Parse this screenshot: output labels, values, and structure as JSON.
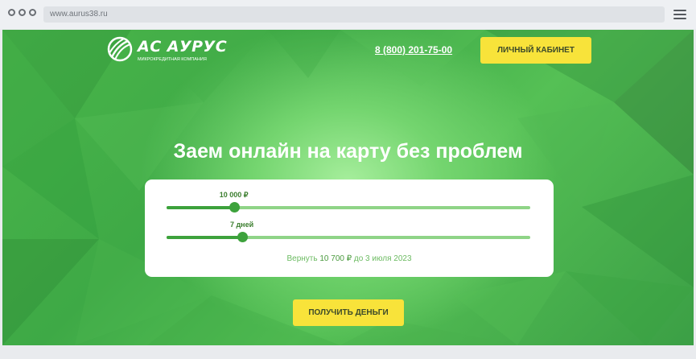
{
  "browser": {
    "url": "www.aurus38.ru"
  },
  "header": {
    "logo_name": "АС АУРУС",
    "logo_subtitle": "МИКРОКРЕДИТНАЯ КОМПАНИЯ",
    "phone": "8 (800) 201-75-00",
    "cabinet_label": "ЛИЧНЫЙ КАБИНЕТ"
  },
  "hero": {
    "title": "Заем онлайн на карту без проблем"
  },
  "calculator": {
    "amount": {
      "label": "10 000 ₽",
      "level": 0.185
    },
    "term": {
      "label": "7 дней",
      "level": 0.207
    },
    "summary": {
      "prefix": "Вернуть",
      "amount": "10 700 ₽",
      "suffix": "до 3 июля 2023"
    }
  },
  "cta": {
    "label": "ПОЛУЧИТЬ ДЕНЬГИ"
  },
  "colors": {
    "accent_yellow": "#f8e33a",
    "brand_green": "#3da23c",
    "track_green": "#8fd487"
  },
  "icons": [
    "browser-dots-icon",
    "menu-icon",
    "logo-globe-icon"
  ]
}
